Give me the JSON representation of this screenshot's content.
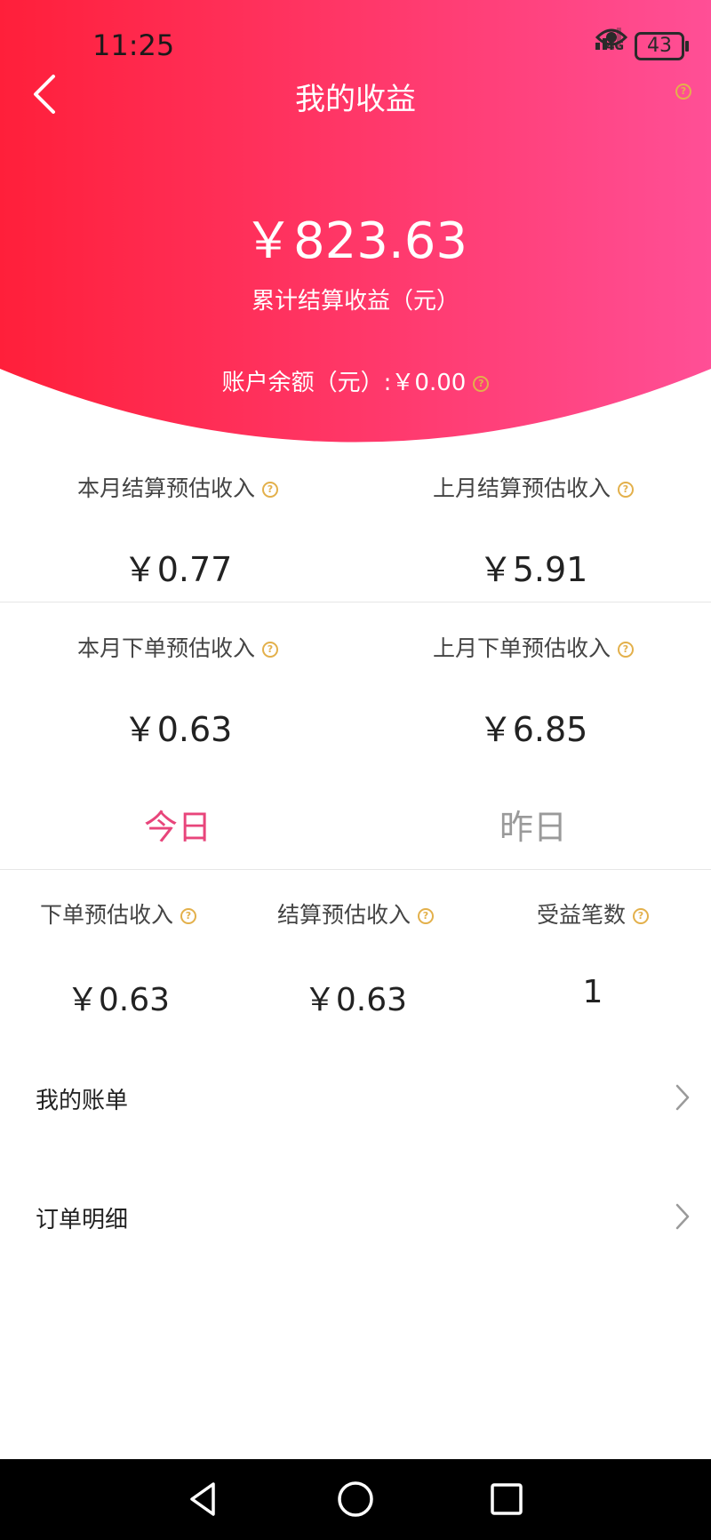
{
  "status_bar": {
    "time": "11:25",
    "network": "4G",
    "battery": "43"
  },
  "header": {
    "title": "我的收益"
  },
  "summary": {
    "total_amount": "￥823.63",
    "total_label": "累计结算收益（元）",
    "balance_text": "账户余额（元）:￥0.00"
  },
  "monthly": [
    {
      "label": "本月结算预估收入",
      "value": "￥0.77"
    },
    {
      "label": "上月结算预估收入",
      "value": "￥5.91"
    },
    {
      "label": "本月下单预估收入",
      "value": "￥0.63"
    },
    {
      "label": "上月下单预估收入",
      "value": "￥6.85"
    }
  ],
  "tabs": [
    {
      "label": "今日",
      "active": true
    },
    {
      "label": "昨日",
      "active": false
    }
  ],
  "daily": [
    {
      "label": "下单预估收入",
      "value": "￥0.63"
    },
    {
      "label": "结算预估收入",
      "value": "￥0.63"
    },
    {
      "label": "受益笔数",
      "value": "1"
    }
  ],
  "menu": [
    {
      "label": "我的账单"
    },
    {
      "label": "订单明细"
    }
  ],
  "colors": {
    "gradient_start": "#ff1f3a",
    "gradient_end": "#ff4f96",
    "accent": "#e8457b",
    "help_icon": "#e3b04b",
    "nav_bar": "#000000"
  }
}
